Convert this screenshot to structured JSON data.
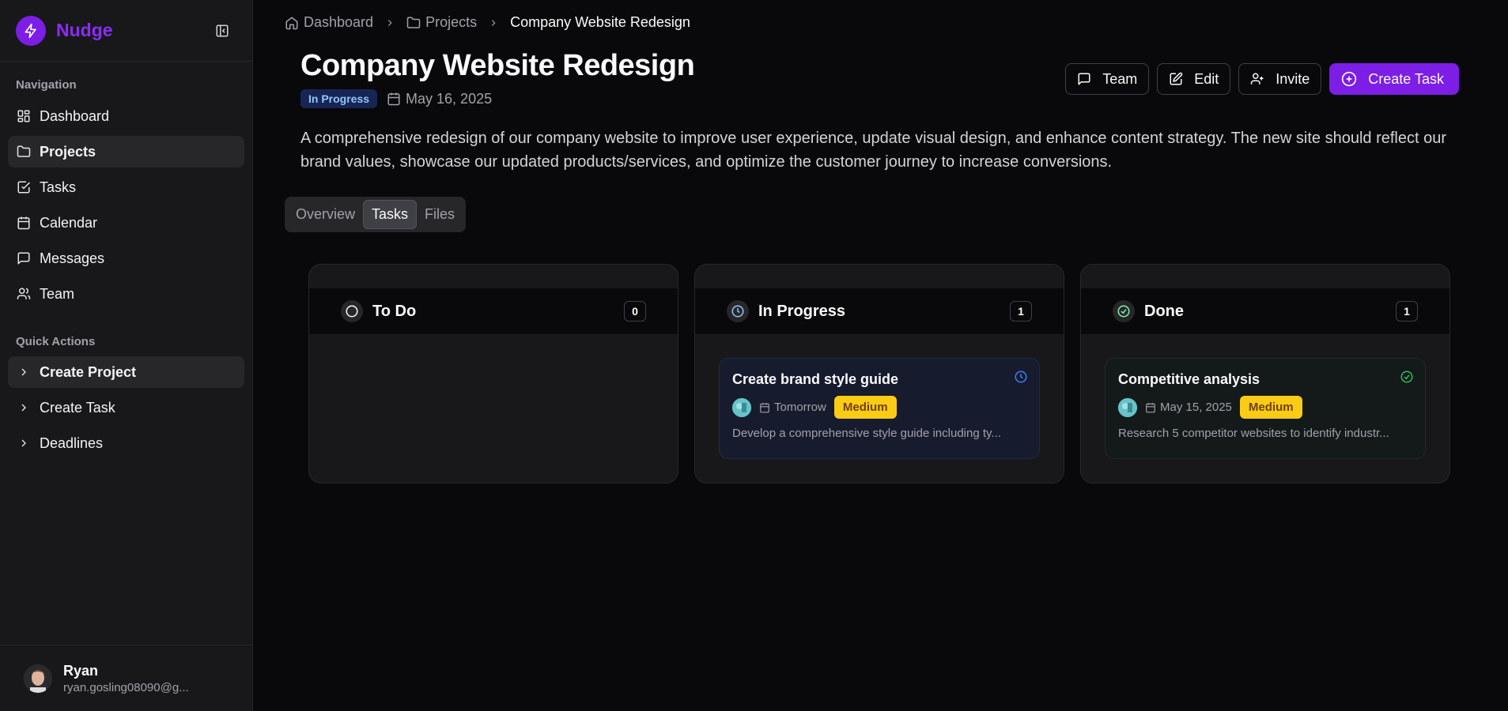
{
  "app": {
    "name": "Nudge"
  },
  "sidebar": {
    "nav_label": "Navigation",
    "nav_items": [
      {
        "label": "Dashboard",
        "icon": "dashboard-icon",
        "active": false
      },
      {
        "label": "Projects",
        "icon": "folder-icon",
        "active": true
      },
      {
        "label": "Tasks",
        "icon": "checkbox-icon",
        "active": false
      },
      {
        "label": "Calendar",
        "icon": "calendar-icon",
        "active": false
      },
      {
        "label": "Messages",
        "icon": "message-icon",
        "active": false
      },
      {
        "label": "Team",
        "icon": "users-icon",
        "active": false
      }
    ],
    "quick_label": "Quick Actions",
    "quick_items": [
      {
        "label": "Create Project",
        "active": true
      },
      {
        "label": "Create Task",
        "active": false
      },
      {
        "label": "Deadlines",
        "active": false
      }
    ],
    "user": {
      "name": "Ryan",
      "email": "ryan.gosling08090@g..."
    }
  },
  "breadcrumb": {
    "home": "Dashboard",
    "projects": "Projects",
    "current": "Company Website Redesign"
  },
  "project": {
    "title": "Company Website Redesign",
    "status": "In Progress",
    "date": "May 16, 2025",
    "description": "A comprehensive redesign of our company website to improve user experience, update visual design, and enhance content strategy. The new site should reflect our brand values, showcase our updated products/services, and optimize the customer journey to increase conversions."
  },
  "actions": {
    "team": "Team",
    "edit": "Edit",
    "invite": "Invite",
    "create_task": "Create Task"
  },
  "tabs": [
    "Overview",
    "Tasks",
    "Files"
  ],
  "active_tab": "Tasks",
  "columns": {
    "todo": {
      "title": "To Do",
      "count": "0"
    },
    "progress": {
      "title": "In Progress",
      "count": "1",
      "card": {
        "title": "Create brand style guide",
        "date": "Tomorrow",
        "priority": "Medium",
        "description": "Develop a comprehensive style guide including ty..."
      }
    },
    "done": {
      "title": "Done",
      "count": "1",
      "card": {
        "title": "Competitive analysis",
        "date": "May 15, 2025",
        "priority": "Medium",
        "description": "Research 5 competitor websites to identify industr..."
      }
    }
  },
  "colors": {
    "brand": "#7c1ee6",
    "in_progress": "#3b82f6",
    "done": "#22c55e",
    "priority_medium": "#facc15"
  }
}
